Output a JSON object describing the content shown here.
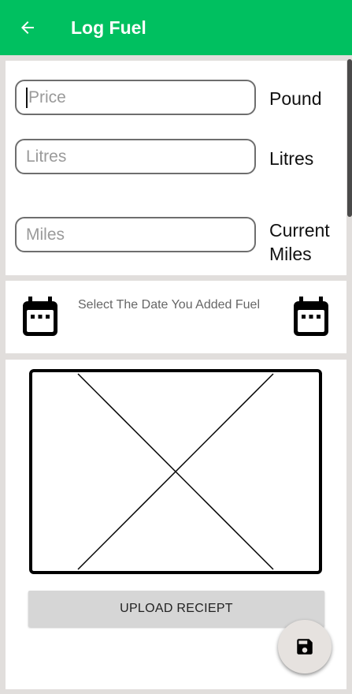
{
  "appbar": {
    "title": "Log Fuel",
    "back_icon": "arrow-back-icon"
  },
  "form": {
    "price": {
      "placeholder": "Price",
      "unit": "Pound"
    },
    "litres": {
      "placeholder": "Litres",
      "unit": "Litres"
    },
    "miles": {
      "placeholder": "Miles",
      "unit_line1": "Current",
      "unit_line2": "Miles"
    }
  },
  "date": {
    "prompt": "Select The Date You Added Fuel",
    "icon": "calendar-icon"
  },
  "receipt": {
    "upload_label": "UPLOAD RECIEPT"
  },
  "fab": {
    "icon": "save-icon"
  },
  "colors": {
    "appbar": "#00c060",
    "background": "#e1dedc"
  }
}
